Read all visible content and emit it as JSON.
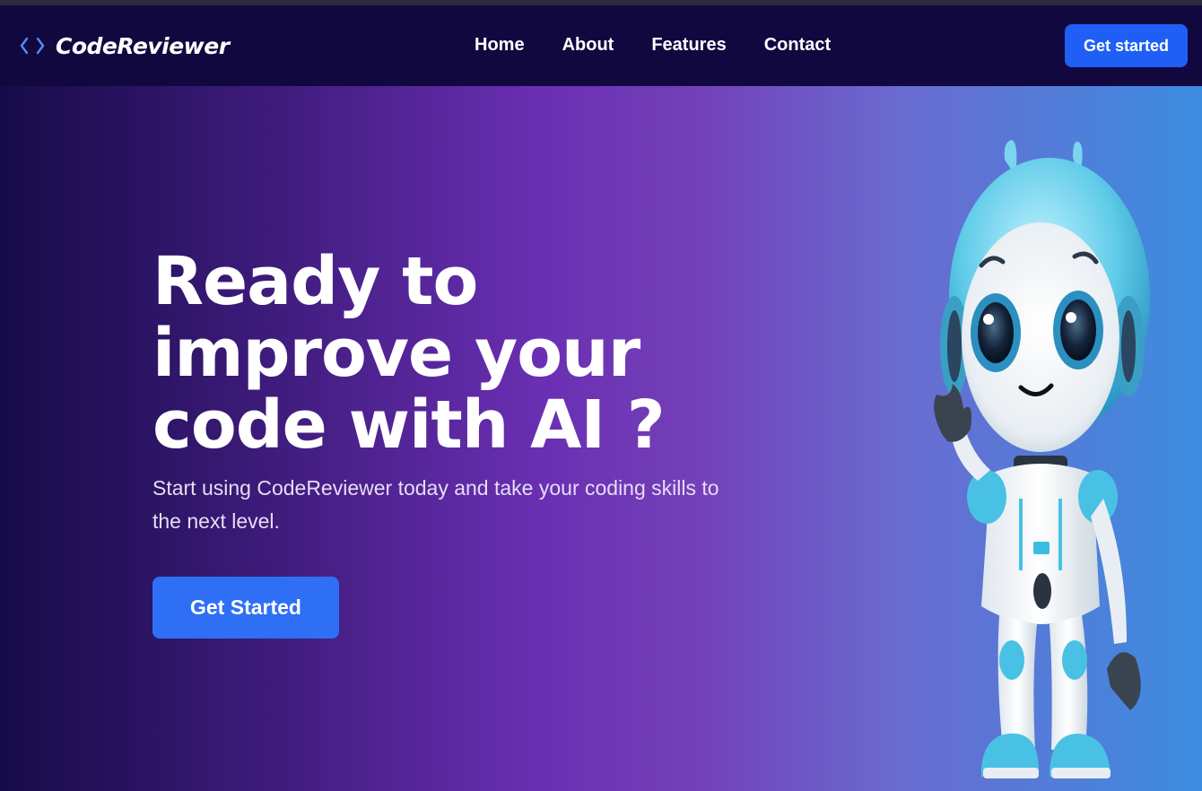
{
  "brand": {
    "name": "CodeReviewer",
    "icon": "code-brackets-icon",
    "accent": "#4f8cff"
  },
  "nav": {
    "links": [
      "Home",
      "About",
      "Features",
      "Contact"
    ],
    "cta_label": "Get started",
    "cta_color": "#1f5ff5"
  },
  "hero": {
    "headline": "Ready to improve your code with AI ?",
    "subtitle": "Start using CodeReviewer today and take your coding skills to the next level.",
    "cta_label": "Get Started",
    "illustration": "robot-mascot-waving",
    "gradient": [
      "#160b48",
      "#6a2fb3",
      "#3c8de0"
    ]
  }
}
